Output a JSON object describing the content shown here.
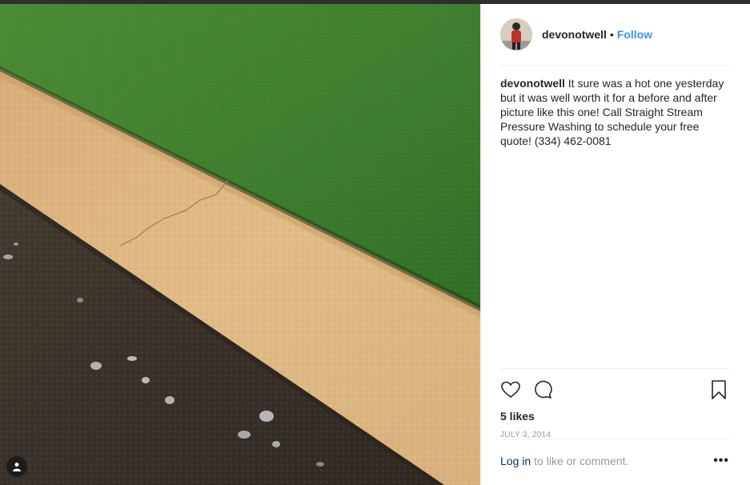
{
  "post": {
    "username": "devonotwell",
    "separator": "•",
    "follow_label": "Follow",
    "caption_user": "devonotwell",
    "caption_text": "It sure was a hot one yesterday but it was well worth it for a before and after picture like this one! Call Straight Stream Pressure Washing to schedule your free quote! (334) 462-0081",
    "likes": "5 likes",
    "date": "JULY 3, 2014",
    "login_link": "Log in",
    "login_rest": "to like or comment.",
    "more_label": "•••"
  },
  "icons": [
    "heart-icon",
    "comment-icon",
    "bookmark-icon",
    "user-tag-icon"
  ],
  "colors": {
    "link": "#3897f0",
    "text": "#262626",
    "muted": "#999999",
    "grass": "#3f7d2c",
    "curb": "#dcb47e",
    "asphalt": "#3a332c"
  }
}
